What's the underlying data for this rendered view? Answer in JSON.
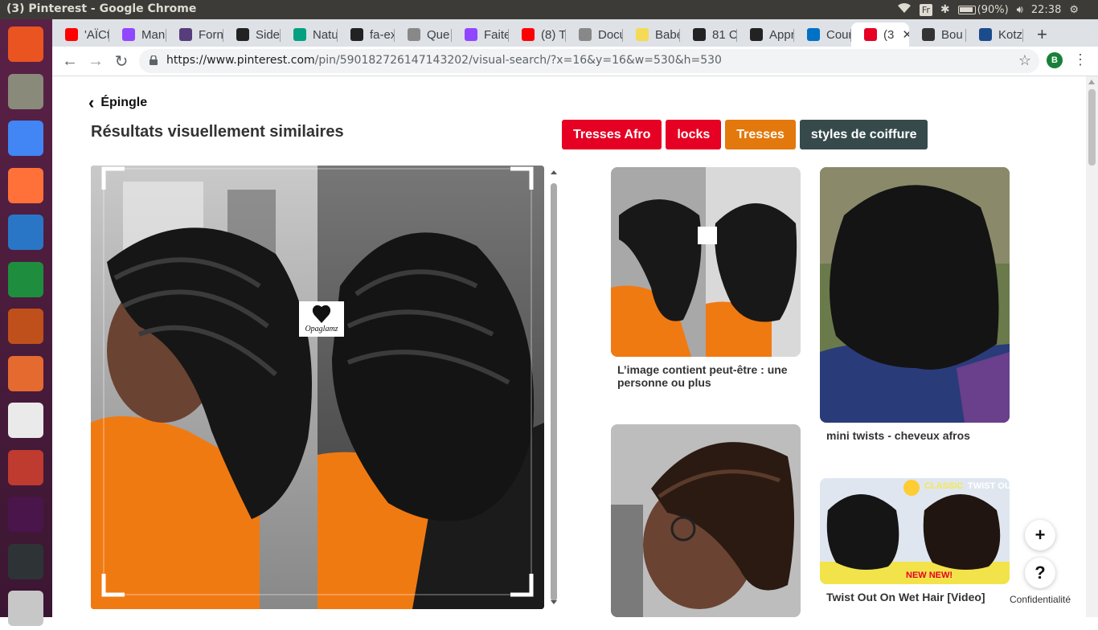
{
  "os": {
    "window_title": "(3) Pinterest - Google Chrome",
    "keyboard_layout": "Fr",
    "battery": "(90%)",
    "time": "22:38"
  },
  "launcher": {
    "items": [
      {
        "name": "ubuntu-dash-icon",
        "color": "#e95420"
      },
      {
        "name": "files-icon",
        "color": "#8a8a7a"
      },
      {
        "name": "chrome-icon",
        "color": "#4285f4"
      },
      {
        "name": "firefox-icon",
        "color": "#ff7139"
      },
      {
        "name": "writer-icon",
        "color": "#2a76c6"
      },
      {
        "name": "calc-icon",
        "color": "#1e8e3e"
      },
      {
        "name": "impress-icon",
        "color": "#c0501b"
      },
      {
        "name": "software-center-icon",
        "color": "#e46a2f"
      },
      {
        "name": "amazon-icon",
        "color": "#eaeaea"
      },
      {
        "name": "system-settings-icon",
        "color": "#bf3b2f"
      },
      {
        "name": "slack-icon",
        "color": "#4a154b"
      },
      {
        "name": "terminal-icon",
        "color": "#2e3436"
      },
      {
        "name": "workspaces-icon",
        "color": "#c7c7c7"
      }
    ]
  },
  "tabs": [
    {
      "label": "'AÏCt",
      "icon": "youtube-icon",
      "color": "#ff0000"
    },
    {
      "label": "Man",
      "icon": "twitch-icon",
      "color": "#9146ff"
    },
    {
      "label": "Forn",
      "icon": "bootstrap-icon",
      "color": "#563d7c"
    },
    {
      "label": "Side",
      "icon": "codepen-icon",
      "color": "#222222"
    },
    {
      "label": "Natu",
      "icon": "pexels-icon",
      "color": "#05a081"
    },
    {
      "label": "fa-ex",
      "icon": "fontawesome-icon",
      "color": "#222222"
    },
    {
      "label": "Que",
      "icon": "document-icon",
      "color": "#888888"
    },
    {
      "label": "Faite",
      "icon": "twitch-icon",
      "color": "#9146ff"
    },
    {
      "label": "(8) T",
      "icon": "youtube-icon",
      "color": "#ff0000"
    },
    {
      "label": "Docu",
      "icon": "document-icon",
      "color": "#888888"
    },
    {
      "label": "Babe",
      "icon": "babel-icon",
      "color": "#f5da55"
    },
    {
      "label": "81 C",
      "icon": "gitbook-icon",
      "color": "#222222"
    },
    {
      "label": "Appr",
      "icon": "github-icon",
      "color": "#222222"
    },
    {
      "label": "Cour",
      "icon": "outlook-icon",
      "color": "#0072c6"
    },
    {
      "label": "(3",
      "icon": "pinterest-icon",
      "color": "#e60023",
      "active": true,
      "close": "✕"
    },
    {
      "label": "Bou",
      "icon": "page-icon",
      "color": "#333333"
    },
    {
      "label": "Kotz",
      "icon": "stripe-icon",
      "color": "#1a4b8c"
    }
  ],
  "new_tab": "+",
  "address": {
    "host": "https://www.pinterest.com",
    "path": "/pin/590182726147143202/visual-search/?x=16&y=16&w=530&h=530",
    "profile_initial": "B"
  },
  "page": {
    "back_label": "Épingle",
    "results_title": "Résultats visuellement similaires",
    "tags": [
      {
        "label": "Tresses Afro",
        "color": "#e60023"
      },
      {
        "label": "locks",
        "color": "#e60023"
      },
      {
        "label": "Tresses",
        "color": "#e3780c"
      },
      {
        "label": "styles de coiffure",
        "color": "#364a4c"
      }
    ],
    "main_image_watermark": "Opaglamz",
    "pins": [
      {
        "caption": "L’image contient peut-être : une personne ou plus"
      },
      {
        "caption": "mini twists - cheveux afros"
      },
      {
        "caption": ""
      },
      {
        "caption": "Twist Out On Wet Hair [Video]",
        "overlay_left": "CLASSIC",
        "overlay_right": "TWIST OUT",
        "overlay_bottom": "NEW NEW!"
      }
    ],
    "fab_add": "+",
    "fab_help": "?",
    "confidentiality": "Confidentialité"
  }
}
